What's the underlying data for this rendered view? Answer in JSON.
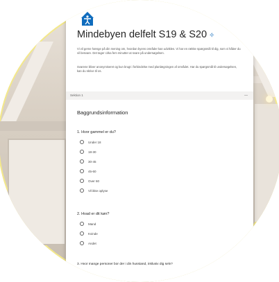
{
  "colors": {
    "brand_blue": "#0f6cbd",
    "text": "#242424",
    "muted": "#555555"
  },
  "form": {
    "title": "Mindebyen delfelt S19 & S20",
    "description_1": "Vi vil gerne hænge på din mening om, hvordan byens områder kan udvikles. Vi har en række spørgsmål til dig, som vi håber du vil besvare. Det tager cirka fem minutter at svare på undersøgelsen.",
    "description_2": "Svarene bliver anonymiseret og kun brugt i forbindelse med planlægningen af området. Har du spørgsmål til undersøgelsen, kan du skrive til os.",
    "section_label": "Sektion 1",
    "section_title": "Baggrundsinformation",
    "questions": [
      {
        "label": "1. Hvor gammel er du?",
        "options": [
          "Under 18",
          "18-30",
          "30-45",
          "45-60",
          "Over 60",
          "Vil ikke oplyse"
        ]
      },
      {
        "label": "2. Hvad er dit køn?",
        "options": [
          "Mand",
          "Kvinde",
          "Andet"
        ]
      },
      {
        "label": "3. Hvor mange personer bor der i din husstand, inklusiv dig selv?",
        "options": []
      }
    ]
  }
}
